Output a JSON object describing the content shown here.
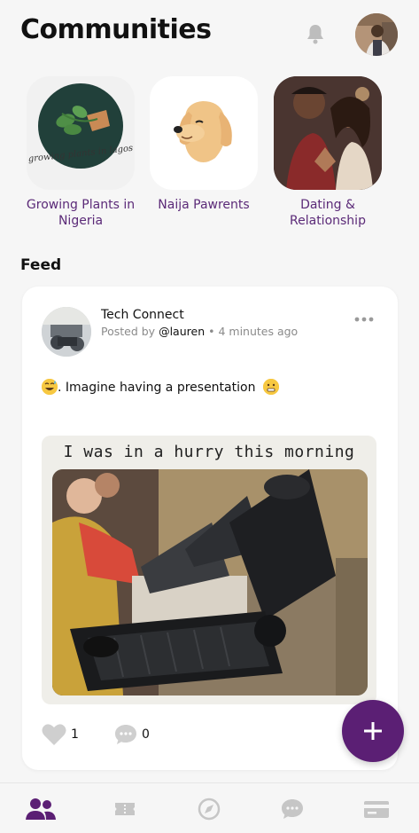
{
  "header": {
    "title": "Communities",
    "icons": [
      "bell-icon",
      "user-avatar"
    ]
  },
  "communities": [
    {
      "label": "Growing Plants in Nigeria",
      "logo_text": "growing plants in lagos"
    },
    {
      "label": "Naija Pawrents"
    },
    {
      "label": "Dating & Relationship"
    }
  ],
  "feed": {
    "title": "Feed",
    "post": {
      "community": "Tech Connect",
      "posted_by_prefix": "Posted by",
      "username": "@lauren",
      "separator": "•",
      "time": "4 minutes ago",
      "text": ". Imagine having a presentation",
      "image_caption": "I was in a hurry this morning",
      "likes": "1",
      "comments": "0"
    }
  },
  "fab": {
    "icon": "plus-icon"
  },
  "bottom_nav": {
    "items": [
      "communities-icon",
      "ticket-icon",
      "compass-icon",
      "chat-icon",
      "card-icon"
    ],
    "active_color": "#5b1f74",
    "inactive_color": "#c6c6c6"
  },
  "colors": {
    "accent": "#5b1f74",
    "label": "#5b2a78"
  }
}
